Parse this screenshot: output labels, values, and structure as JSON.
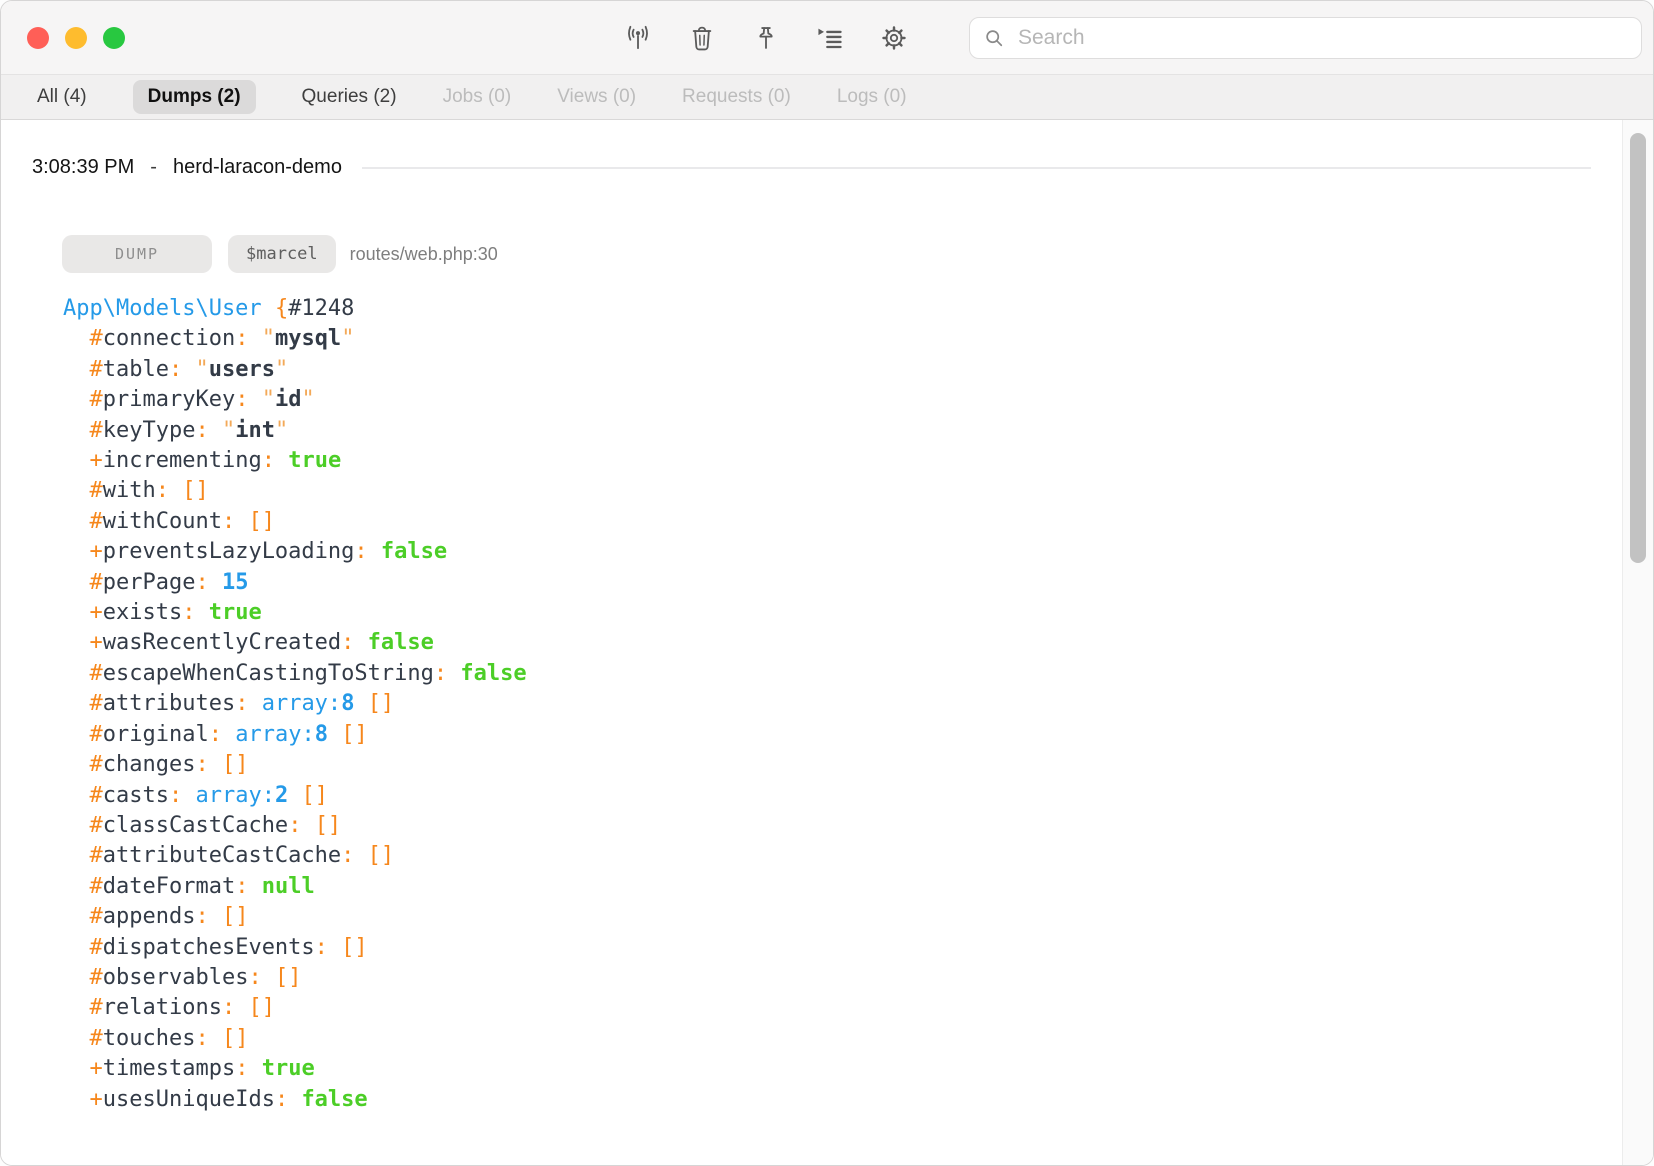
{
  "window": {
    "toolbar": {
      "icons": [
        {
          "name": "broadcast-icon"
        },
        {
          "name": "trash-icon"
        },
        {
          "name": "pin-icon"
        },
        {
          "name": "auto-scroll-icon"
        },
        {
          "name": "settings-icon"
        }
      ],
      "search": {
        "placeholder": "Search",
        "value": ""
      }
    }
  },
  "tabs": [
    {
      "id": "all",
      "label": "All (4)",
      "state": "normal"
    },
    {
      "id": "dumps",
      "label": "Dumps (2)",
      "state": "selected"
    },
    {
      "id": "queries",
      "label": "Queries (2)",
      "state": "normal"
    },
    {
      "id": "jobs",
      "label": "Jobs (0)",
      "state": "disabled"
    },
    {
      "id": "views",
      "label": "Views (0)",
      "state": "disabled"
    },
    {
      "id": "requests",
      "label": "Requests (0)",
      "state": "disabled"
    },
    {
      "id": "logs",
      "label": "Logs (0)",
      "state": "disabled"
    }
  ],
  "entry": {
    "time": "3:08:39 PM",
    "separator": "-",
    "project": "herd-laracon-demo",
    "badges": [
      {
        "label": "DUMP"
      },
      {
        "label": "$marcel"
      }
    ],
    "location": "routes/web.php:30"
  },
  "dump": {
    "lines": [
      [
        [
          "cls",
          "App\\Models\\User"
        ],
        [
          "plain",
          " "
        ],
        [
          "sym",
          "{"
        ],
        [
          "ref",
          "#1248"
        ]
      ],
      [
        [
          "plain",
          "  "
        ],
        [
          "sym",
          "#"
        ],
        [
          "name",
          "connection"
        ],
        [
          "sym",
          ":"
        ],
        [
          "plain",
          " "
        ],
        [
          "q",
          "\""
        ],
        [
          "str",
          "mysql"
        ],
        [
          "q",
          "\""
        ]
      ],
      [
        [
          "plain",
          "  "
        ],
        [
          "sym",
          "#"
        ],
        [
          "name",
          "table"
        ],
        [
          "sym",
          ":"
        ],
        [
          "plain",
          " "
        ],
        [
          "q",
          "\""
        ],
        [
          "str",
          "users"
        ],
        [
          "q",
          "\""
        ]
      ],
      [
        [
          "plain",
          "  "
        ],
        [
          "sym",
          "#"
        ],
        [
          "name",
          "primaryKey"
        ],
        [
          "sym",
          ":"
        ],
        [
          "plain",
          " "
        ],
        [
          "q",
          "\""
        ],
        [
          "str",
          "id"
        ],
        [
          "q",
          "\""
        ]
      ],
      [
        [
          "plain",
          "  "
        ],
        [
          "sym",
          "#"
        ],
        [
          "name",
          "keyType"
        ],
        [
          "sym",
          ":"
        ],
        [
          "plain",
          " "
        ],
        [
          "q",
          "\""
        ],
        [
          "str",
          "int"
        ],
        [
          "q",
          "\""
        ]
      ],
      [
        [
          "plain",
          "  "
        ],
        [
          "sym",
          "+"
        ],
        [
          "name",
          "incrementing"
        ],
        [
          "sym",
          ":"
        ],
        [
          "plain",
          " "
        ],
        [
          "const",
          "true"
        ]
      ],
      [
        [
          "plain",
          "  "
        ],
        [
          "sym",
          "#"
        ],
        [
          "name",
          "with"
        ],
        [
          "sym",
          ":"
        ],
        [
          "plain",
          " "
        ],
        [
          "sym",
          "[]"
        ]
      ],
      [
        [
          "plain",
          "  "
        ],
        [
          "sym",
          "#"
        ],
        [
          "name",
          "withCount"
        ],
        [
          "sym",
          ":"
        ],
        [
          "plain",
          " "
        ],
        [
          "sym",
          "[]"
        ]
      ],
      [
        [
          "plain",
          "  "
        ],
        [
          "sym",
          "+"
        ],
        [
          "name",
          "preventsLazyLoading"
        ],
        [
          "sym",
          ":"
        ],
        [
          "plain",
          " "
        ],
        [
          "const",
          "false"
        ]
      ],
      [
        [
          "plain",
          "  "
        ],
        [
          "sym",
          "#"
        ],
        [
          "name",
          "perPage"
        ],
        [
          "sym",
          ":"
        ],
        [
          "plain",
          " "
        ],
        [
          "num",
          "15"
        ]
      ],
      [
        [
          "plain",
          "  "
        ],
        [
          "sym",
          "+"
        ],
        [
          "name",
          "exists"
        ],
        [
          "sym",
          ":"
        ],
        [
          "plain",
          " "
        ],
        [
          "const",
          "true"
        ]
      ],
      [
        [
          "plain",
          "  "
        ],
        [
          "sym",
          "+"
        ],
        [
          "name",
          "wasRecentlyCreated"
        ],
        [
          "sym",
          ":"
        ],
        [
          "plain",
          " "
        ],
        [
          "const",
          "false"
        ]
      ],
      [
        [
          "plain",
          "  "
        ],
        [
          "sym",
          "#"
        ],
        [
          "name",
          "escapeWhenCastingToString"
        ],
        [
          "sym",
          ":"
        ],
        [
          "plain",
          " "
        ],
        [
          "const",
          "false"
        ]
      ],
      [
        [
          "plain",
          "  "
        ],
        [
          "sym",
          "#"
        ],
        [
          "name",
          "attributes"
        ],
        [
          "sym",
          ":"
        ],
        [
          "plain",
          " "
        ],
        [
          "note",
          "array:"
        ],
        [
          "num",
          "8"
        ],
        [
          "plain",
          " "
        ],
        [
          "sym",
          "[]"
        ]
      ],
      [
        [
          "plain",
          "  "
        ],
        [
          "sym",
          "#"
        ],
        [
          "name",
          "original"
        ],
        [
          "sym",
          ":"
        ],
        [
          "plain",
          " "
        ],
        [
          "note",
          "array:"
        ],
        [
          "num",
          "8"
        ],
        [
          "plain",
          " "
        ],
        [
          "sym",
          "[]"
        ]
      ],
      [
        [
          "plain",
          "  "
        ],
        [
          "sym",
          "#"
        ],
        [
          "name",
          "changes"
        ],
        [
          "sym",
          ":"
        ],
        [
          "plain",
          " "
        ],
        [
          "sym",
          "[]"
        ]
      ],
      [
        [
          "plain",
          "  "
        ],
        [
          "sym",
          "#"
        ],
        [
          "name",
          "casts"
        ],
        [
          "sym",
          ":"
        ],
        [
          "plain",
          " "
        ],
        [
          "note",
          "array:"
        ],
        [
          "num",
          "2"
        ],
        [
          "plain",
          " "
        ],
        [
          "sym",
          "[]"
        ]
      ],
      [
        [
          "plain",
          "  "
        ],
        [
          "sym",
          "#"
        ],
        [
          "name",
          "classCastCache"
        ],
        [
          "sym",
          ":"
        ],
        [
          "plain",
          " "
        ],
        [
          "sym",
          "[]"
        ]
      ],
      [
        [
          "plain",
          "  "
        ],
        [
          "sym",
          "#"
        ],
        [
          "name",
          "attributeCastCache"
        ],
        [
          "sym",
          ":"
        ],
        [
          "plain",
          " "
        ],
        [
          "sym",
          "[]"
        ]
      ],
      [
        [
          "plain",
          "  "
        ],
        [
          "sym",
          "#"
        ],
        [
          "name",
          "dateFormat"
        ],
        [
          "sym",
          ":"
        ],
        [
          "plain",
          " "
        ],
        [
          "const",
          "null"
        ]
      ],
      [
        [
          "plain",
          "  "
        ],
        [
          "sym",
          "#"
        ],
        [
          "name",
          "appends"
        ],
        [
          "sym",
          ":"
        ],
        [
          "plain",
          " "
        ],
        [
          "sym",
          "[]"
        ]
      ],
      [
        [
          "plain",
          "  "
        ],
        [
          "sym",
          "#"
        ],
        [
          "name",
          "dispatchesEvents"
        ],
        [
          "sym",
          ":"
        ],
        [
          "plain",
          " "
        ],
        [
          "sym",
          "[]"
        ]
      ],
      [
        [
          "plain",
          "  "
        ],
        [
          "sym",
          "#"
        ],
        [
          "name",
          "observables"
        ],
        [
          "sym",
          ":"
        ],
        [
          "plain",
          " "
        ],
        [
          "sym",
          "[]"
        ]
      ],
      [
        [
          "plain",
          "  "
        ],
        [
          "sym",
          "#"
        ],
        [
          "name",
          "relations"
        ],
        [
          "sym",
          ":"
        ],
        [
          "plain",
          " "
        ],
        [
          "sym",
          "[]"
        ]
      ],
      [
        [
          "plain",
          "  "
        ],
        [
          "sym",
          "#"
        ],
        [
          "name",
          "touches"
        ],
        [
          "sym",
          ":"
        ],
        [
          "plain",
          " "
        ],
        [
          "sym",
          "[]"
        ]
      ],
      [
        [
          "plain",
          "  "
        ],
        [
          "sym",
          "+"
        ],
        [
          "name",
          "timestamps"
        ],
        [
          "sym",
          ":"
        ],
        [
          "plain",
          " "
        ],
        [
          "const",
          "true"
        ]
      ],
      [
        [
          "plain",
          "  "
        ],
        [
          "sym",
          "+"
        ],
        [
          "name",
          "usesUniqueIds"
        ],
        [
          "sym",
          ":"
        ],
        [
          "plain",
          " "
        ],
        [
          "const",
          "false"
        ]
      ]
    ]
  },
  "colors": {
    "syntax_symbol": "#F6871C",
    "syntax_quote": "#F3A958",
    "syntax_class_and_number": "#259AE8",
    "syntax_constant": "#4CCE27",
    "syntax_text": "#333B47",
    "badge_bg": "#E9E8E7",
    "traffic_red": "#FF5F57",
    "traffic_yellow": "#FEBC2E",
    "traffic_green": "#28C840"
  }
}
